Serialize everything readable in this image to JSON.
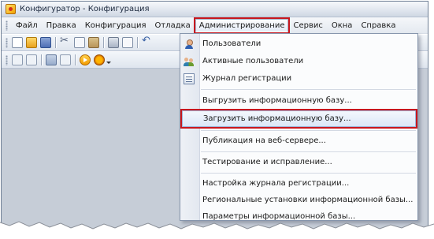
{
  "window": {
    "title": "Конфигуратор - Конфигурация"
  },
  "menubar": {
    "items": [
      {
        "label": "Файл"
      },
      {
        "label": "Правка"
      },
      {
        "label": "Конфигурация"
      },
      {
        "label": "Отладка"
      },
      {
        "label": "Администрирование",
        "active": true
      },
      {
        "label": "Сервис"
      },
      {
        "label": "Окна"
      },
      {
        "label": "Справка"
      }
    ]
  },
  "toolbar1": {
    "icons": [
      "new-document-icon",
      "open-folder-icon",
      "save-icon",
      "cut-icon",
      "copy-icon",
      "paste-icon",
      "print-icon",
      "print-preview-icon",
      "undo-icon"
    ]
  },
  "toolbar2": {
    "icons": [
      "configuration-tree-icon",
      "module-icon",
      "grid-icon",
      "form-icon",
      "run-icon",
      "debug-icon"
    ]
  },
  "admin_menu": {
    "items": [
      {
        "label": "Пользователи",
        "icon": "user-icon"
      },
      {
        "label": "Активные пользователи",
        "icon": "active-users-icon"
      },
      {
        "label": "Журнал регистрации",
        "icon": "event-log-icon"
      },
      {
        "label": "Выгрузить информационную базу..."
      },
      {
        "label": "Загрузить информационную базу...",
        "selected": true
      },
      {
        "label": "Публикация на веб-сервере..."
      },
      {
        "label": "Тестирование и исправление..."
      },
      {
        "label": "Настройка журнала регистрации..."
      },
      {
        "label": "Региональные установки информационной базы..."
      },
      {
        "label": "Параметры информационной базы..."
      }
    ]
  },
  "colors": {
    "highlight_outline": "#c8171e",
    "selected_item_bg": "#dce7f7",
    "window_bg": "#d7dde6"
  }
}
